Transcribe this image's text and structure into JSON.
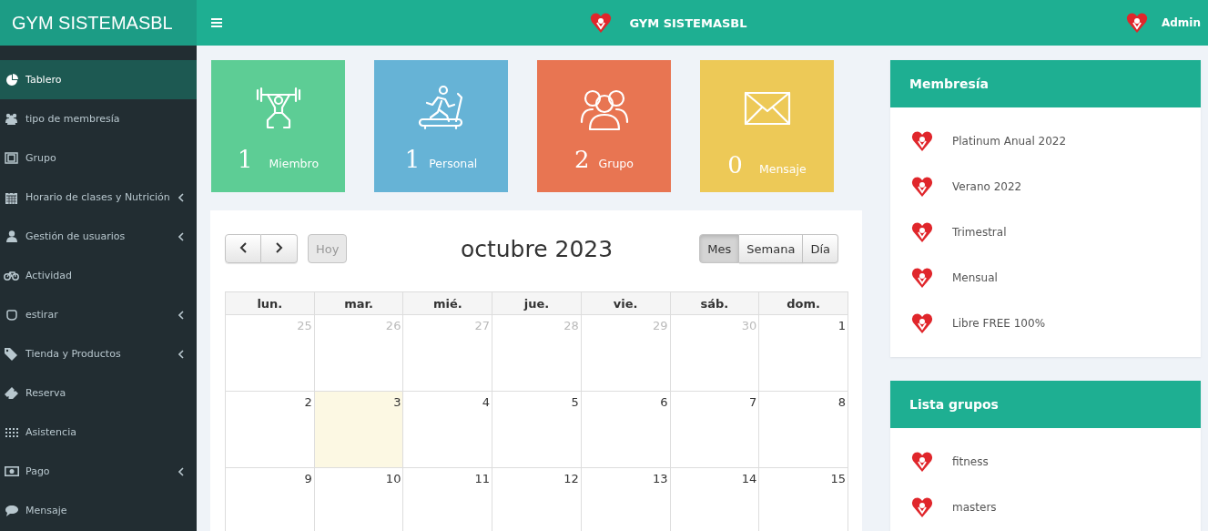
{
  "header": {
    "brand": "GYM SISTEMASBL",
    "title": "GYM SISTEMASBL",
    "user": "Admin"
  },
  "sidebar": {
    "items": [
      {
        "label": "Tablero",
        "selected": true,
        "expandable": false
      },
      {
        "label": "tipo de membresía",
        "selected": false,
        "expandable": false
      },
      {
        "label": "Grupo",
        "selected": false,
        "expandable": false
      },
      {
        "label": "Horario de clases y Nutrición",
        "selected": false,
        "expandable": true
      },
      {
        "label": "Gestión de usuarios",
        "selected": false,
        "expandable": true
      },
      {
        "label": "Actividad",
        "selected": false,
        "expandable": false
      },
      {
        "label": "estirar",
        "selected": false,
        "expandable": true
      },
      {
        "label": "Tienda y Productos",
        "selected": false,
        "expandable": true
      },
      {
        "label": "Reserva",
        "selected": false,
        "expandable": false
      },
      {
        "label": "Asistencia",
        "selected": false,
        "expandable": false
      },
      {
        "label": "Pago",
        "selected": false,
        "expandable": true
      },
      {
        "label": "Mensaje",
        "selected": false,
        "expandable": false
      }
    ]
  },
  "stats": [
    {
      "count": "1",
      "label": "Miembro",
      "color": "#5dcd95"
    },
    {
      "count": "1",
      "label": "Personal",
      "color": "#66b3d6"
    },
    {
      "count": "2",
      "label": "Grupo",
      "color": "#e87552"
    },
    {
      "count": "0",
      "label": "Mensaje",
      "color": "#edc957"
    }
  ],
  "calendar": {
    "today_button": {
      "label": "Hoy",
      "disabled": true
    },
    "title": "octubre 2023",
    "views": [
      {
        "label": "Mes",
        "selected": true
      },
      {
        "label": "Semana",
        "selected": false
      },
      {
        "label": "Día",
        "selected": false
      }
    ],
    "weekdays": [
      "lun.",
      "mar.",
      "mié.",
      "jue.",
      "vie.",
      "sáb.",
      "dom."
    ],
    "weeks": [
      [
        {
          "day": "25",
          "other_month": true,
          "today": false
        },
        {
          "day": "26",
          "other_month": true,
          "today": false
        },
        {
          "day": "27",
          "other_month": true,
          "today": false
        },
        {
          "day": "28",
          "other_month": true,
          "today": false
        },
        {
          "day": "29",
          "other_month": true,
          "today": false
        },
        {
          "day": "30",
          "other_month": true,
          "today": false
        },
        {
          "day": "1",
          "other_month": false,
          "today": false
        }
      ],
      [
        {
          "day": "2",
          "other_month": false,
          "today": false
        },
        {
          "day": "3",
          "other_month": false,
          "today": true
        },
        {
          "day": "4",
          "other_month": false,
          "today": false
        },
        {
          "day": "5",
          "other_month": false,
          "today": false
        },
        {
          "day": "6",
          "other_month": false,
          "today": false
        },
        {
          "day": "7",
          "other_month": false,
          "today": false
        },
        {
          "day": "8",
          "other_month": false,
          "today": false
        }
      ],
      [
        {
          "day": "9",
          "other_month": false,
          "today": false
        },
        {
          "day": "10",
          "other_month": false,
          "today": false
        },
        {
          "day": "11",
          "other_month": false,
          "today": false
        },
        {
          "day": "12",
          "other_month": false,
          "today": false
        },
        {
          "day": "13",
          "other_month": false,
          "today": false
        },
        {
          "day": "14",
          "other_month": false,
          "today": false
        },
        {
          "day": "15",
          "other_month": false,
          "today": false
        }
      ]
    ]
  },
  "panels": [
    {
      "title": "Membresía",
      "items": [
        "Platinum Anual 2022",
        "Verano 2022",
        "Trimestral",
        "Mensual",
        "Libre FREE 100%"
      ]
    },
    {
      "title": "Lista grupos",
      "items": [
        "fitness",
        "masters"
      ]
    }
  ]
}
